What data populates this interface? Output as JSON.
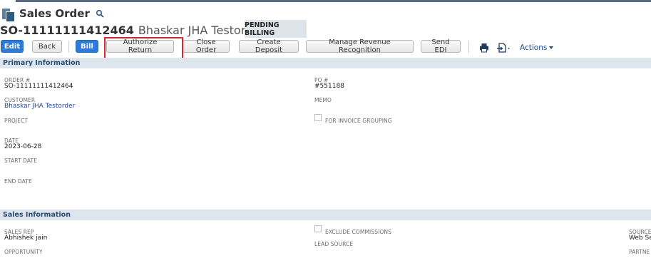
{
  "page": {
    "title": "Sales Order",
    "record_number": "SO-11111111412464",
    "record_name": "Bhaskar JHA Testorder",
    "status": "PENDING BILLING"
  },
  "toolbar": {
    "edit": "Edit",
    "back": "Back",
    "bill": "Bill",
    "authorize_return": "Authorize Return",
    "close_order": "Close Order",
    "create_deposit": "Create Deposit",
    "manage_revenue": "Manage Revenue Recognition",
    "send_edi": "Send EDI",
    "actions": "Actions"
  },
  "primary": {
    "header": "Primary Information",
    "order_label": "ORDER #",
    "order_value": "SO-11111111412464",
    "customer_label": "CUSTOMER",
    "customer_value": "Bhaskar JHA Testorder",
    "project_label": "PROJECT",
    "date_label": "DATE",
    "date_value": "2023-06-28",
    "start_date_label": "START DATE",
    "end_date_label": "END DATE",
    "po_label": "PO #",
    "po_value": "#551188",
    "memo_label": "MEMO",
    "invoice_grouping_label": "FOR INVOICE GROUPING"
  },
  "sales": {
    "header": "Sales Information",
    "sales_rep_label": "SALES REP",
    "sales_rep_value": "Abhishek jain",
    "opportunity_label": "OPPORTUNITY",
    "exclude_commissions_label": "EXCLUDE COMMISSIONS",
    "lead_source_label": "LEAD SOURCE",
    "source_label": "SOURCE",
    "source_value": "Web Se",
    "partner_label": "PARTNE"
  },
  "colors": {
    "primary_button": "#2d7bd6",
    "section_header_bg": "#dde5ee",
    "highlight_border": "#d9262e",
    "link": "#1c4c8a"
  }
}
